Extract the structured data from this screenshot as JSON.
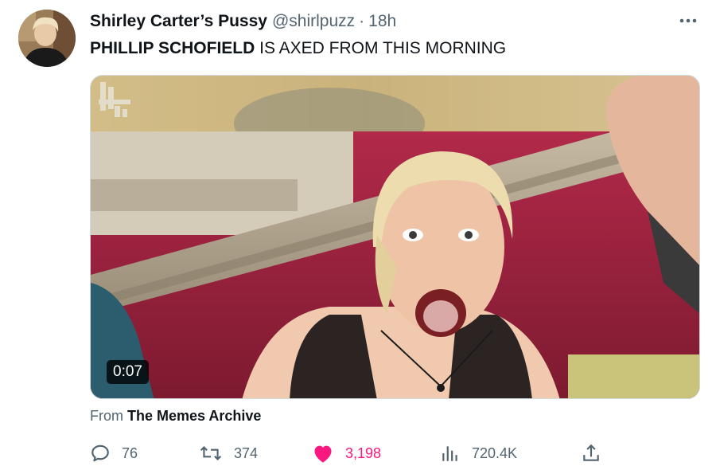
{
  "tweet": {
    "author_name": "Shirley Carter’s Pussy",
    "handle": "@shirlpuzz",
    "separator": "·",
    "time": "18h",
    "text_bold": "PHILLIP SCHOFIELD",
    "text_rest": " IS AXED FROM THIS MORNING",
    "more_icon": "more-horizontal-icon"
  },
  "media": {
    "duration": "0:07",
    "channel_logo": "4"
  },
  "source": {
    "prefix": "From ",
    "name": "The Memes Archive"
  },
  "actions": {
    "replies": "76",
    "retweets": "374",
    "likes": "3,198",
    "views": "720.4K",
    "like_color": "#f91880",
    "muted_color": "#536471"
  }
}
